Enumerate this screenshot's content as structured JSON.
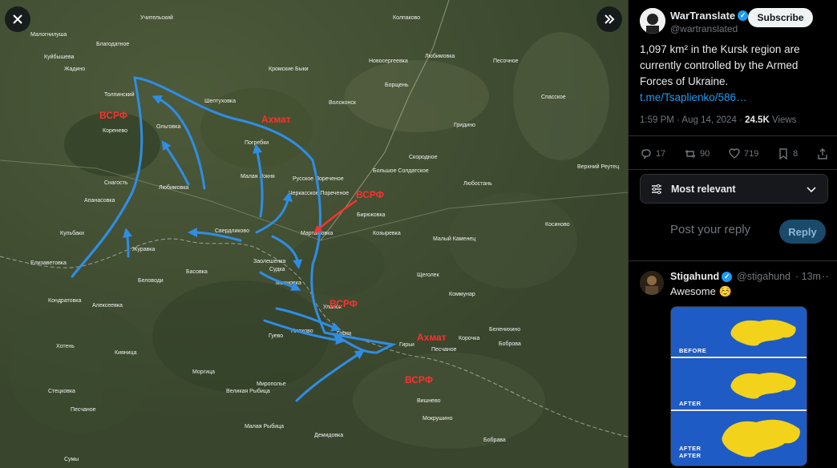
{
  "viewer": {
    "close_icon": "close-icon",
    "expand_icon": "double-chevron-right-icon",
    "map": {
      "place_labels": [
        {
          "text": "Малогнилуша"
        },
        {
          "text": "Куйбышева"
        },
        {
          "text": "Жадино"
        },
        {
          "text": "Благодатное"
        },
        {
          "text": "Учительский"
        },
        {
          "text": "Колпаково"
        },
        {
          "text": "Кромские Быки"
        },
        {
          "text": "Новосергеевка"
        },
        {
          "text": "Любимовка"
        },
        {
          "text": "Песочное"
        },
        {
          "text": "Большое Солдатское"
        },
        {
          "text": "Толпинский"
        },
        {
          "text": "Коренево"
        },
        {
          "text": "Ольговка"
        },
        {
          "text": "Шептуховка"
        },
        {
          "text": "Волоконск"
        },
        {
          "text": "Борщень"
        },
        {
          "text": "Спасское"
        },
        {
          "text": "Погребки"
        },
        {
          "text": "Малая Локня"
        },
        {
          "text": "Русское Пореченое"
        },
        {
          "text": "Черкасское Пореченое"
        },
        {
          "text": "Мартыновка"
        },
        {
          "text": "Бирюковка"
        },
        {
          "text": "Козыревка"
        },
        {
          "text": "Снагость"
        },
        {
          "text": "Любимовка"
        },
        {
          "text": "Апанасовка"
        },
        {
          "text": "Свердликово"
        },
        {
          "text": "Кульбаки"
        },
        {
          "text": "Журавка"
        },
        {
          "text": "Елизаветовка"
        },
        {
          "text": "Беловоди"
        },
        {
          "text": "Басовка"
        },
        {
          "text": "Заолешенка"
        },
        {
          "text": "Судка"
        },
        {
          "text": "Махновка"
        },
        {
          "text": "Уланок"
        },
        {
          "text": "Плехово"
        },
        {
          "text": "Горки"
        },
        {
          "text": "Гуево"
        },
        {
          "text": "Гирьи"
        },
        {
          "text": "Песчаное"
        },
        {
          "text": "Корочка"
        },
        {
          "text": "Кондратовка"
        },
        {
          "text": "Алексеевка"
        },
        {
          "text": "Хотень"
        },
        {
          "text": "Кияница"
        },
        {
          "text": "Мирополье"
        },
        {
          "text": "Моргица"
        },
        {
          "text": "Великая Рыбица"
        },
        {
          "text": "Малая Рыбица"
        },
        {
          "text": "Стецковка"
        },
        {
          "text": "Песчаное"
        },
        {
          "text": "Демидовка"
        },
        {
          "text": "Вишнево"
        },
        {
          "text": "Мокрушино"
        },
        {
          "text": "Сумы"
        },
        {
          "text": "Малый Каменец"
        },
        {
          "text": "Щеголек"
        },
        {
          "text": "Коммунар"
        },
        {
          "text": "Косиново"
        },
        {
          "text": "Беленихино"
        },
        {
          "text": "Боброва"
        },
        {
          "text": "Бобрава"
        },
        {
          "text": "Скородное"
        },
        {
          "text": "Любостань"
        },
        {
          "text": "Верхний Реутец"
        },
        {
          "text": "Гридино"
        }
      ],
      "force_labels": [
        {
          "text": "ВСРФ",
          "color": "#ff3030"
        },
        {
          "text": "Ахмат",
          "color": "#ff3030"
        },
        {
          "text": "ВСРФ",
          "color": "#ff3030"
        },
        {
          "text": "ВСРФ",
          "color": "#ff3030"
        },
        {
          "text": "Ахмат",
          "color": "#ff3030"
        },
        {
          "text": "ВСРФ",
          "color": "#ff3030"
        }
      ],
      "arrow_color": "#2f8de4"
    }
  },
  "post": {
    "author_name": "WarTranslate",
    "author_handle": "@wartranslated",
    "subscribe_label": "Subscribe",
    "more_icon": "more-icon",
    "text_line": "1,097 km² in the Kursk region are currently controlled by the Armed Forces of Ukraine.",
    "link": "t.me/Tsaplienko/586…",
    "time": "1:59 PM · Aug 14, 2024 · ",
    "views_count": "24.5K",
    "views_label": " Views",
    "actions": {
      "replies": "17",
      "reposts": "90",
      "likes": "719",
      "bookmarks": "8"
    },
    "sort_label": "Most relevant",
    "reply_placeholder": "Post your reply",
    "reply_button": "Reply"
  },
  "reply": {
    "name": "Stigahund",
    "handle": "@stigahund",
    "time": "· 13m",
    "text": "Awesome ☺️",
    "image_labels": [
      "BEFORE",
      "AFTER",
      "AFTER AFTER"
    ],
    "image_colors": {
      "map_fill": "#f2d21b",
      "background": "#1f5bc4"
    }
  },
  "colors": {
    "accent": "#1d9bf0",
    "text": "#e7e9ea",
    "muted": "#71767b"
  }
}
